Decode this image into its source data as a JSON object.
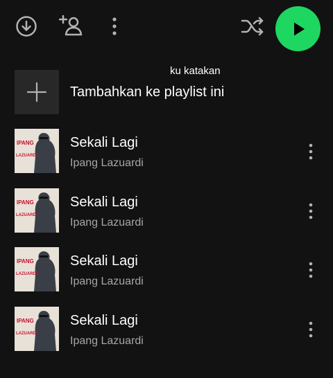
{
  "toolbar": {
    "download_icon": "download-circle-icon",
    "add_user_icon": "add-user-icon",
    "more_icon": "more-vertical-icon",
    "shuffle_icon": "shuffle-icon",
    "play_icon": "play-icon",
    "play_button_color": "#1ed760"
  },
  "caption": "ku katakan",
  "add_to_playlist": {
    "icon": "plus-icon",
    "label": "Tambahkan ke playlist ini"
  },
  "tracks": [
    {
      "title": "Sekali Lagi",
      "artist": "Ipang Lazuardi",
      "art_text": "IPANG",
      "art_subtext": "LAZUARDI"
    },
    {
      "title": "Sekali Lagi",
      "artist": "Ipang Lazuardi",
      "art_text": "IPANG",
      "art_subtext": "LAZUARDI"
    },
    {
      "title": "Sekali Lagi",
      "artist": "Ipang Lazuardi",
      "art_text": "IPANG",
      "art_subtext": "LAZUARDI"
    },
    {
      "title": "Sekali Lagi",
      "artist": "Ipang Lazuardi",
      "art_text": "IPANG",
      "art_subtext": "LAZUARDI"
    }
  ],
  "colors": {
    "background": "#121212",
    "text_primary": "#ffffff",
    "text_secondary": "#a7a7a7",
    "accent": "#1ed760"
  }
}
